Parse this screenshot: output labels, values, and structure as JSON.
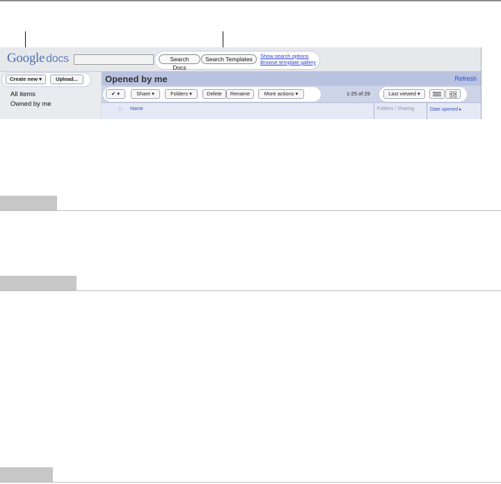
{
  "app": {
    "logo_google": "Google",
    "logo_docs": "docs",
    "search_docs_label": "Search Docs",
    "search_templates_label": "Search Templates",
    "show_search_options": "Show search options",
    "browse_template_gallery": "Browse template gallery",
    "refresh": "Refresh"
  },
  "sidebar": {
    "create_new_label": "Create new ▾",
    "upload_label": "Upload...",
    "items": [
      {
        "label": "All items"
      },
      {
        "label": "Owned by me"
      }
    ]
  },
  "main": {
    "title": "Opened by me",
    "toolbar": {
      "select_label": "✔ ▾",
      "share_label": "Share ▾",
      "folders_label": "Folders ▾",
      "delete_label": "Delete",
      "rename_label": "Rename",
      "more_actions_label": "More actions ▾",
      "pagination": "1-25 of 29",
      "sort_label": "Last viewed ▾"
    },
    "columns": [
      "Name",
      "Folders / Sharing",
      "Date opened ▸"
    ]
  },
  "icons": {
    "list_view": "list-view-icon",
    "grid_view": "grid-view-icon",
    "star": "star-icon"
  },
  "colors": {
    "link": "#2a3fd1",
    "main_bar": "#b9c3e0",
    "section_bar": "#c7c7c7"
  }
}
